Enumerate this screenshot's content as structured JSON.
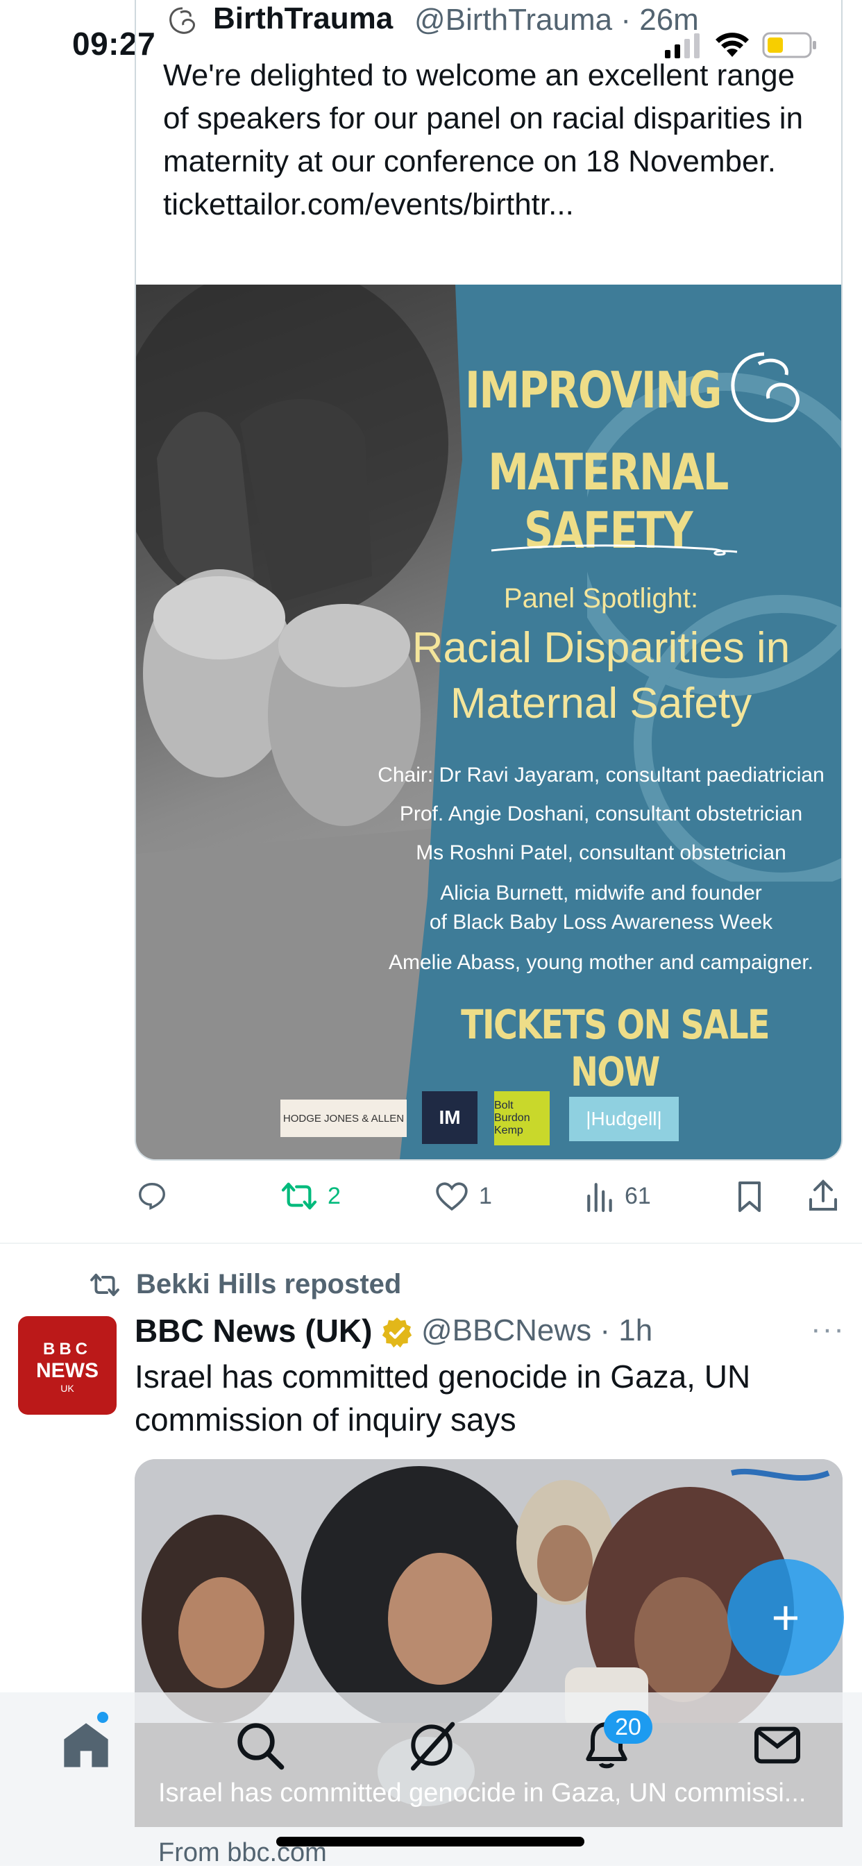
{
  "status_bar": {
    "time": "09:27"
  },
  "tweet1": {
    "display_name": "BirthTrauma",
    "handle": "@BirthTrauma",
    "age": "26m",
    "text": "We're delighted to welcome an excellent range of speakers for our panel on racial disparities in maternity at our conference on 18 November.  tickettailor.com/events/birthtr...",
    "poster": {
      "title_line1": "IMPROVING",
      "title_line2": "MATERNAL SAFETY",
      "spotlight_label": "Panel Spotlight:",
      "panel_title_line1": "Racial Disparities in",
      "panel_title_line2": "Maternal Safety",
      "speakers": [
        "Chair: Dr Ravi Jayaram, consultant paediatrician",
        "Prof. Angie Doshani, consultant obstetrician",
        "Ms Roshni Patel, consultant obstetrician",
        "Alicia Burnett, midwife and founder",
        "of Black Baby Loss Awareness Week",
        "Amelie Abass, young mother and campaigner."
      ],
      "cta": "TICKETS ON SALE NOW",
      "sponsors": [
        "HODGE JONES & ALLEN",
        "IM",
        "Bolt Burdon Kemp",
        "|Hudgell|"
      ]
    },
    "actions": {
      "reply": "",
      "retweets": "2",
      "likes": "1",
      "views": "61"
    },
    "colors": {
      "retweet_active": "#00ba7c",
      "poster_teal": "#3e7c98",
      "poster_yellow": "#eedd88"
    }
  },
  "tweet2": {
    "repost_label": "Bekki Hills reposted",
    "display_name": "BBC News (UK)",
    "handle": "@BBCNews",
    "age": "1h",
    "more": "···",
    "avatar_text_top": "BBC",
    "avatar_text_mid": "NEWS",
    "avatar_text_bottom": "UK",
    "text": "Israel has committed genocide in Gaza, UN commission of inquiry says",
    "card_caption": "Israel has committed genocide in Gaza, UN commissi...",
    "card_from": "From bbc.com",
    "colors": {
      "avatar_red": "#bb1919",
      "verified_gold": "#e2b719"
    }
  },
  "fab": {
    "label": "+"
  },
  "bottom_nav": {
    "items": [
      "home-icon",
      "search-icon",
      "grok-icon",
      "notifications-icon",
      "messages-icon"
    ],
    "notifications_count": "20"
  }
}
